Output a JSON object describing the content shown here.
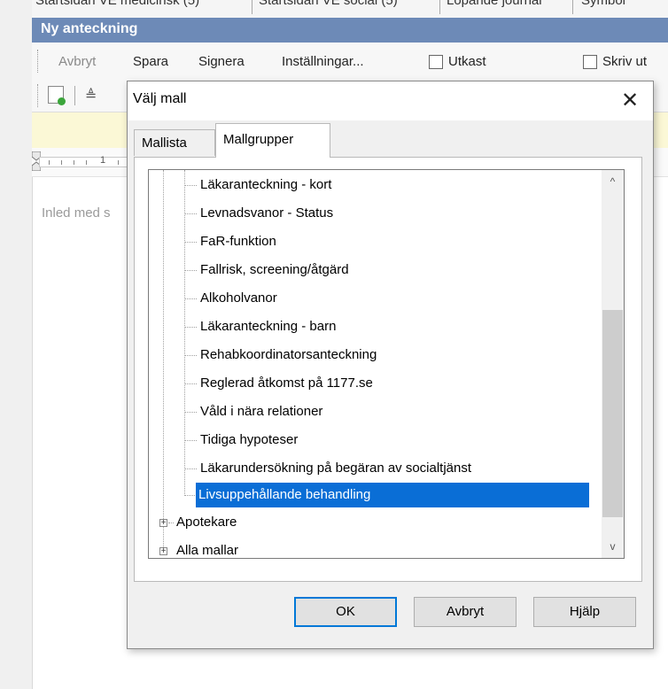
{
  "top_tabs": [
    "Startsidan VE medicinsk (5)",
    "Startsidan VE social (5)",
    "Löpande journal",
    "Symbol"
  ],
  "window": {
    "title": "Ny anteckning"
  },
  "menubar": {
    "items": [
      "Avbryt",
      "Spara",
      "Signera",
      "Inställningar..."
    ],
    "utkast_label": "Utkast",
    "skriv_ut_label": "Skriv ut"
  },
  "ruler": {
    "number": "1"
  },
  "editor": {
    "placeholder": "Inled med s"
  },
  "dialog": {
    "title": "Välj mall",
    "close_glyph": "✕",
    "tabs": [
      {
        "label": "Mallista",
        "active": false
      },
      {
        "label": "Mallgrupper",
        "active": true
      }
    ],
    "tree_items": [
      "Läkaranteckning - kort",
      "Levnadsvanor - Status",
      "FaR-funktion",
      "Fallrisk, screening/åtgärd",
      "Alkoholvanor",
      "Läkaranteckning - barn",
      "Rehabkoordinatorsanteckning",
      "Reglerad åtkomst på 1177.se",
      "Våld i nära relationer",
      "Tidiga hypoteser",
      "Läkarundersökning på begäran av socialtjänst",
      "Livsuppehållande behandling"
    ],
    "selected_item": "Livsuppehållande behandling",
    "group_items": [
      "Apotekare",
      "Alla mallar"
    ],
    "expander_glyph": "+",
    "scroll_up_glyph": "^",
    "scroll_down_glyph": "v",
    "buttons": {
      "ok": "OK",
      "cancel": "Avbryt",
      "help": "Hjälp"
    }
  },
  "colors": {
    "title_bar": "#6d8ab7",
    "selection": "#0a6ed6",
    "default_button_border": "#0078d7",
    "info_bar": "#fbf8d6"
  }
}
